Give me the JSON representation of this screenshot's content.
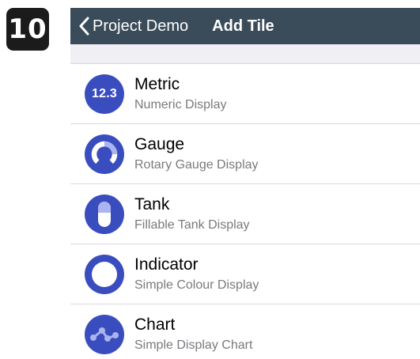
{
  "step_number": "10",
  "nav": {
    "back_label": "Project Demo",
    "title": "Add Tile"
  },
  "colors": {
    "navbar": "#3a4b59",
    "icon_bg": "#3a4dbf",
    "icon_light": "#aab4f0"
  },
  "tiles": [
    {
      "title": "Metric",
      "subtitle": "Numeric Display",
      "icon": "metric-icon",
      "icon_text": "12.3"
    },
    {
      "title": "Gauge",
      "subtitle": "Rotary Gauge Display",
      "icon": "gauge-icon"
    },
    {
      "title": "Tank",
      "subtitle": "Fillable Tank Display",
      "icon": "tank-icon"
    },
    {
      "title": "Indicator",
      "subtitle": "Simple Colour Display",
      "icon": "indicator-icon"
    },
    {
      "title": "Chart",
      "subtitle": "Simple Display Chart",
      "icon": "chart-icon"
    }
  ]
}
